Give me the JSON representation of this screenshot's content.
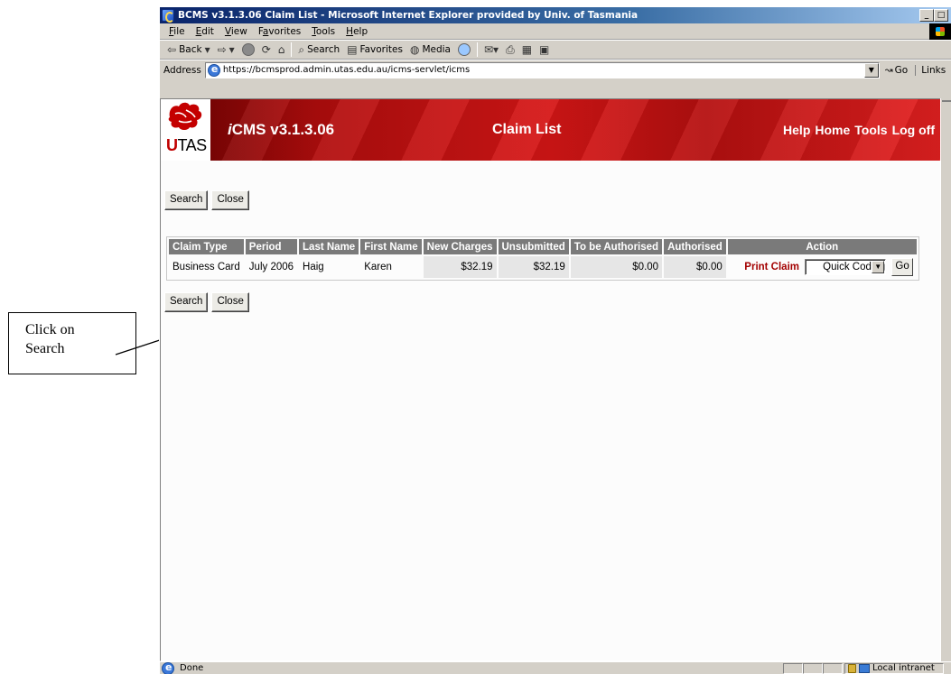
{
  "window": {
    "title": "BCMS v3.1.3.06 Claim List - Microsoft Internet Explorer provided by Univ. of Tasmania",
    "controls": [
      "_",
      "□",
      "×"
    ]
  },
  "menu": [
    {
      "pre": "",
      "u": "F",
      "post": "ile"
    },
    {
      "pre": "",
      "u": "E",
      "post": "dit"
    },
    {
      "pre": "",
      "u": "V",
      "post": "iew"
    },
    {
      "pre": "F",
      "u": "a",
      "post": "vorites"
    },
    {
      "pre": "",
      "u": "T",
      "post": "ools"
    },
    {
      "pre": "",
      "u": "H",
      "post": "elp"
    }
  ],
  "toolbar": {
    "back": "Back",
    "search": "Search",
    "favorites": "Favorites",
    "media": "Media"
  },
  "address": {
    "label": "Address",
    "url": "https://bcmsprod.admin.utas.edu.au/icms-servlet/icms",
    "go": "Go",
    "links": "Links"
  },
  "banner": {
    "logo_text": "TAS",
    "logo_u": "U",
    "app_prefix": "i",
    "app_title": "CMS v3.1.3.06",
    "page_title": "Claim List",
    "links": [
      "Help",
      "Home",
      "Tools",
      "Log off"
    ]
  },
  "buttons": {
    "search": "Search",
    "close": "Close"
  },
  "table": {
    "headers": [
      "Claim Type",
      "Period",
      "Last Name",
      "First Name",
      "New Charges",
      "Unsubmitted",
      "To be Authorised",
      "Authorised",
      "Action"
    ],
    "rows": [
      {
        "claim_type": "Business Card",
        "period": "July 2006",
        "last_name": "Haig",
        "first_name": "Karen",
        "new_charges": "$32.19",
        "unsubmitted": "$32.19",
        "to_be_authorised": "$0.00",
        "authorised": "$0.00",
        "print_claim": "Print Claim",
        "action_select": "Quick Coding",
        "go": "Go"
      }
    ]
  },
  "status": {
    "text": "Done",
    "zone": "Local intranet"
  },
  "callout": {
    "line1": "Click on",
    "line2": "Search"
  },
  "colors": {
    "banner_red": "#d61616",
    "header_grey": "#7a7a7a",
    "print_claim": "#a30000",
    "titlebar": "#0a246a"
  }
}
